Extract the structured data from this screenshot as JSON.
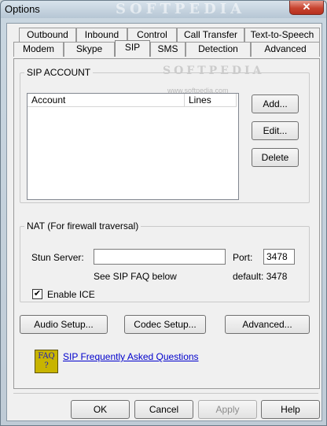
{
  "window": {
    "title": "Options",
    "watermark": "SOFTPEDIA",
    "close_glyph": "✕"
  },
  "tabs": {
    "row_top": [
      {
        "label": "Outbound"
      },
      {
        "label": "Inbound"
      },
      {
        "label": "Control"
      },
      {
        "label": "Call Transfer"
      },
      {
        "label": "Text-to-Speech"
      }
    ],
    "row_bottom": [
      {
        "label": "Modem"
      },
      {
        "label": "Skype"
      },
      {
        "label": "SIP",
        "active": true
      },
      {
        "label": "SMS"
      },
      {
        "label": "Detection"
      },
      {
        "label": "Advanced"
      }
    ]
  },
  "watermark_url": "www.softpedia.com",
  "sip_account": {
    "legend": "SIP ACCOUNT",
    "columns": [
      "Account",
      "Lines"
    ],
    "rows": [],
    "buttons": {
      "add": "Add...",
      "edit": "Edit...",
      "delete": "Delete"
    }
  },
  "nat": {
    "legend": "NAT (For firewall traversal)",
    "stun_label": "Stun Server:",
    "stun_value": "",
    "port_label": "Port:",
    "port_value": "3478",
    "faq_note": "See SIP FAQ below",
    "default_note": "default: 3478",
    "enable_ice_label": "Enable ICE",
    "enable_ice_checked": true
  },
  "setup_buttons": {
    "audio": "Audio Setup...",
    "codec": "Codec Setup...",
    "advanced": "Advanced..."
  },
  "faq": {
    "icon_text_1": "FAQ",
    "icon_text_2": "?",
    "link": "SIP Frequently Asked Questions"
  },
  "footer": {
    "ok": "OK",
    "cancel": "Cancel",
    "apply": "Apply",
    "help": "Help"
  },
  "colors": {
    "accent_link": "#0000cc",
    "close_button": "#c7432f",
    "faq_icon": "#c8b400"
  }
}
